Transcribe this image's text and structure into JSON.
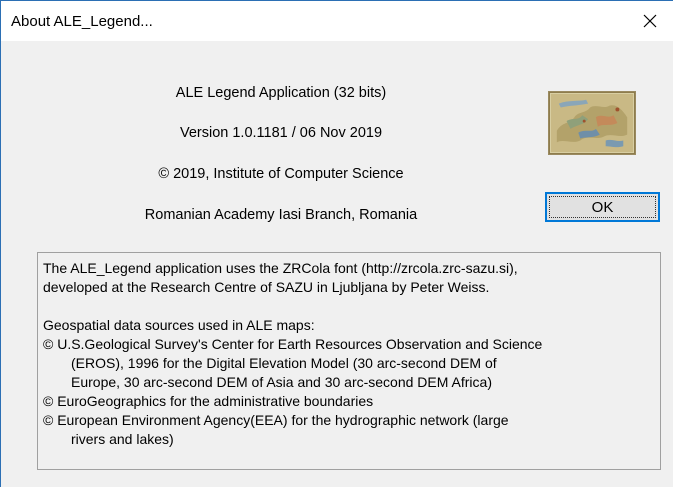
{
  "window": {
    "title": "About ALE_Legend...",
    "close_glyph": "close-icon"
  },
  "about": {
    "app_name": "ALE Legend Application (32 bits)",
    "version": "Version 1.0.1181 / 06 Nov 2019",
    "copyright": "© 2019, Institute of Computer Science",
    "organization": "Romanian Academy Iasi Branch, Romania"
  },
  "buttons": {
    "ok_label": "OK"
  },
  "info": {
    "line1": "The ALE_Legend application uses the ZRCola font (http://zrcola.zrc-sazu.si),",
    "line2": "developed at the Research Centre of SAZU in Ljubljana by Peter Weiss.",
    "line3": "Geospatial data sources used in ALE maps:",
    "line4": "© U.S.Geological Survey's Center for Earth Resources Observation and Science",
    "line5": "(EROS), 1996 for the Digital Elevation Model (30 arc-second DEM of",
    "line6": "Europe, 30 arc-second DEM of Asia and 30 arc-second DEM Africa)",
    "line7": "© EuroGeographics for the administrative boundaries",
    "line8": "© European Environment Agency(EEA) for the hydrographic network (large",
    "line9": "rivers and lakes)"
  },
  "colors": {
    "accent": "#0078d7",
    "window_bg": "#f0f0f0",
    "titlebar_bg": "#ffffff"
  }
}
